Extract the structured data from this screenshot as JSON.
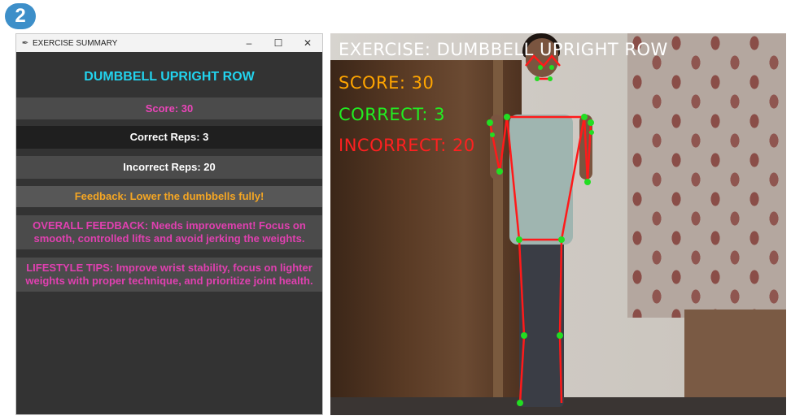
{
  "badge": "2",
  "window": {
    "title": "EXERCISE SUMMARY",
    "minimize": "–",
    "maximize": "☐",
    "close": "✕"
  },
  "summary": {
    "heading": "DUMBBELL UPRIGHT ROW",
    "score": "Score: 30",
    "correct": "Correct Reps: 3",
    "incorrect": "Incorrect Reps: 20",
    "feedback": "Feedback: Lower the dumbbells fully!",
    "overall": "OVERALL FEEDBACK: Needs improvement! Focus on smooth, controlled lifts and avoid jerking the weights.",
    "tips": "LIFESTYLE TIPS: Improve wrist stability, focus on lighter weights with proper technique, and prioritize joint health."
  },
  "camera": {
    "exercise": "EXERCISE: DUMBBELL UPRIGHT ROW",
    "score": "SCORE: 30",
    "correct": "CORRECT: 3",
    "incorrect": "INCORRECT: 20"
  },
  "colors": {
    "heading": "#22d3ee",
    "score": "#ea45b8",
    "feedback": "#f5a623",
    "skeleton_line": "#ff1a1a",
    "skeleton_joint": "#22dd22"
  }
}
